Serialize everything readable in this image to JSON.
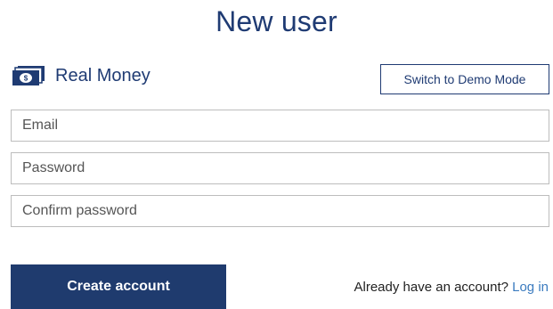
{
  "page": {
    "title": "New user"
  },
  "mode": {
    "label": "Real Money",
    "icon": "money-bill-icon",
    "switch_label": "Switch to Demo Mode"
  },
  "form": {
    "email_placeholder": "Email",
    "password_placeholder": "Password",
    "confirm_placeholder": "Confirm password",
    "email_value": "",
    "password_value": "",
    "confirm_value": "",
    "submit_label": "Create account"
  },
  "login": {
    "prompt": "Already have an account?",
    "link_label": "Log in"
  },
  "colors": {
    "primary": "#1f3b6e",
    "link": "#3b7bbf",
    "border": "#bdbdbd"
  }
}
